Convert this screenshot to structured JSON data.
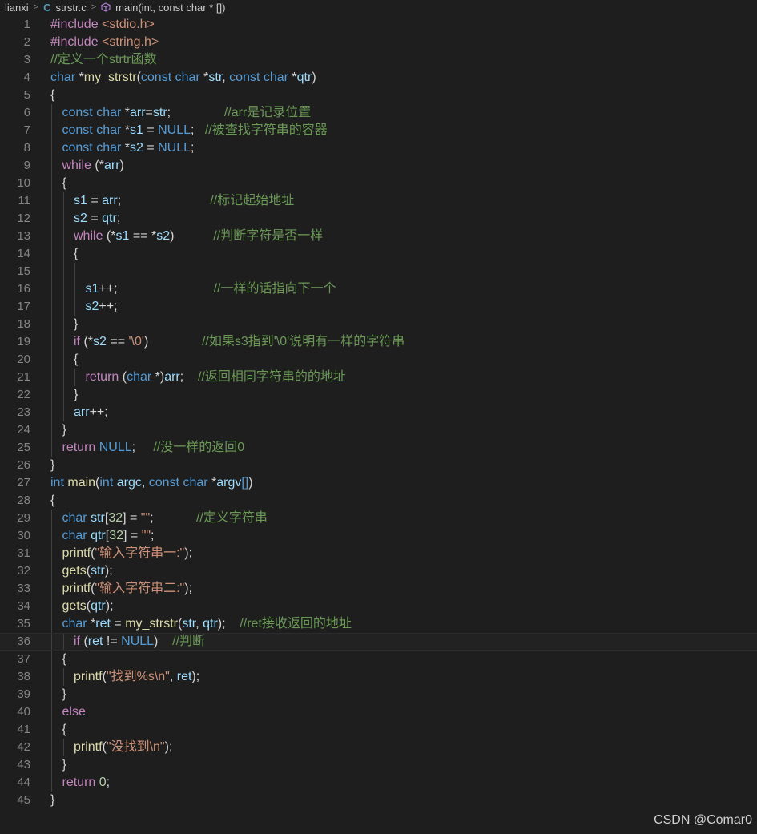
{
  "breadcrumb": {
    "folder": "lianxi",
    "file": "strstr.c",
    "symbol": "main(int, const char * [])"
  },
  "watermark": "CSDN @Comar0",
  "lines": [
    {
      "n": "1",
      "tokens": [
        [
          "pp",
          "#include "
        ],
        [
          "inc",
          "<stdio.h>"
        ]
      ]
    },
    {
      "n": "2",
      "tokens": [
        [
          "pp",
          "#include "
        ],
        [
          "inc",
          "<string.h>"
        ]
      ]
    },
    {
      "n": "3",
      "tokens": [
        [
          "cmt",
          "//定义一个strtr函数"
        ]
      ]
    },
    {
      "n": "4",
      "tokens": [
        [
          "kw",
          "char"
        ],
        [
          "txt",
          " *"
        ],
        [
          "fn",
          "my_strstr"
        ],
        [
          "txt",
          "("
        ],
        [
          "kw",
          "const char"
        ],
        [
          "txt",
          " *"
        ],
        [
          "var",
          "str"
        ],
        [
          "txt",
          ", "
        ],
        [
          "kw",
          "const char"
        ],
        [
          "txt",
          " *"
        ],
        [
          "var",
          "qtr"
        ],
        [
          "txt",
          ")"
        ]
      ]
    },
    {
      "n": "5",
      "tokens": [
        [
          "txt",
          "{"
        ]
      ]
    },
    {
      "n": "6",
      "indent": 1,
      "tokens": [
        [
          "kw",
          "const char"
        ],
        [
          "txt",
          " *"
        ],
        [
          "var",
          "arr"
        ],
        [
          "txt",
          "="
        ],
        [
          "var",
          "str"
        ],
        [
          "txt",
          ";"
        ],
        [
          "txt",
          "               "
        ],
        [
          "cmt",
          "//arr是记录位置"
        ]
      ]
    },
    {
      "n": "7",
      "indent": 1,
      "tokens": [
        [
          "kw",
          "const char"
        ],
        [
          "txt",
          " *"
        ],
        [
          "var",
          "s1"
        ],
        [
          "txt",
          " = "
        ],
        [
          "kw",
          "NULL"
        ],
        [
          "txt",
          ";   "
        ],
        [
          "cmt",
          "//被查找字符串的容器"
        ]
      ]
    },
    {
      "n": "8",
      "indent": 1,
      "tokens": [
        [
          "kw",
          "const char"
        ],
        [
          "txt",
          " *"
        ],
        [
          "var",
          "s2"
        ],
        [
          "txt",
          " = "
        ],
        [
          "kw",
          "NULL"
        ],
        [
          "txt",
          ";"
        ]
      ]
    },
    {
      "n": "9",
      "indent": 1,
      "tokens": [
        [
          "ctl",
          "while"
        ],
        [
          "txt",
          " (*"
        ],
        [
          "var",
          "arr"
        ],
        [
          "txt",
          ")"
        ]
      ]
    },
    {
      "n": "10",
      "indent": 1,
      "tokens": [
        [
          "txt",
          "{"
        ]
      ]
    },
    {
      "n": "11",
      "indent": 2,
      "tokens": [
        [
          "var",
          "s1"
        ],
        [
          "txt",
          " = "
        ],
        [
          "var",
          "arr"
        ],
        [
          "txt",
          ";"
        ],
        [
          "txt",
          "                         "
        ],
        [
          "cmt",
          "//标记起始地址"
        ]
      ]
    },
    {
      "n": "12",
      "indent": 2,
      "tokens": [
        [
          "var",
          "s2"
        ],
        [
          "txt",
          " = "
        ],
        [
          "var",
          "qtr"
        ],
        [
          "txt",
          ";"
        ]
      ]
    },
    {
      "n": "13",
      "indent": 2,
      "tokens": [
        [
          "ctl",
          "while"
        ],
        [
          "txt",
          " (*"
        ],
        [
          "var",
          "s1"
        ],
        [
          "txt",
          " == *"
        ],
        [
          "var",
          "s2"
        ],
        [
          "txt",
          ")"
        ],
        [
          "txt",
          "           "
        ],
        [
          "cmt",
          "//判断字符是否一样"
        ]
      ]
    },
    {
      "n": "14",
      "indent": 2,
      "tokens": [
        [
          "txt",
          "{"
        ]
      ]
    },
    {
      "n": "15",
      "indent": 3,
      "tokens": []
    },
    {
      "n": "16",
      "indent": 3,
      "tokens": [
        [
          "var",
          "s1"
        ],
        [
          "txt",
          "++;"
        ],
        [
          "txt",
          "                           "
        ],
        [
          "cmt",
          "//一样的话指向下一个"
        ]
      ]
    },
    {
      "n": "17",
      "indent": 3,
      "tokens": [
        [
          "var",
          "s2"
        ],
        [
          "txt",
          "++;"
        ]
      ]
    },
    {
      "n": "18",
      "indent": 2,
      "tokens": [
        [
          "txt",
          "}"
        ]
      ]
    },
    {
      "n": "19",
      "indent": 2,
      "tokens": [
        [
          "ctl",
          "if"
        ],
        [
          "txt",
          " (*"
        ],
        [
          "var",
          "s2"
        ],
        [
          "txt",
          " == "
        ],
        [
          "str",
          "'\\0'"
        ],
        [
          "txt",
          ")"
        ],
        [
          "txt",
          "               "
        ],
        [
          "cmt",
          "//如果s3指到'\\0'说明有一样的字符串"
        ]
      ]
    },
    {
      "n": "20",
      "indent": 2,
      "tokens": [
        [
          "txt",
          "{"
        ]
      ]
    },
    {
      "n": "21",
      "indent": 3,
      "tokens": [
        [
          "ctl",
          "return"
        ],
        [
          "txt",
          " ("
        ],
        [
          "kw",
          "char"
        ],
        [
          "txt",
          " *)"
        ],
        [
          "var",
          "arr"
        ],
        [
          "txt",
          ";    "
        ],
        [
          "cmt",
          "//返回相同字符串的的地址"
        ]
      ]
    },
    {
      "n": "22",
      "indent": 2,
      "tokens": [
        [
          "txt",
          "}"
        ]
      ]
    },
    {
      "n": "23",
      "indent": 2,
      "tokens": [
        [
          "var",
          "arr"
        ],
        [
          "txt",
          "++;"
        ]
      ]
    },
    {
      "n": "24",
      "indent": 1,
      "tokens": [
        [
          "txt",
          "}"
        ]
      ]
    },
    {
      "n": "25",
      "indent": 1,
      "tokens": [
        [
          "ctl",
          "return"
        ],
        [
          "txt",
          " "
        ],
        [
          "kw",
          "NULL"
        ],
        [
          "txt",
          ";     "
        ],
        [
          "cmt",
          "//没一样的返回0"
        ]
      ]
    },
    {
      "n": "26",
      "tokens": [
        [
          "txt",
          "}"
        ]
      ]
    },
    {
      "n": "27",
      "tokens": [
        [
          "kw",
          "int"
        ],
        [
          "txt",
          " "
        ],
        [
          "fn",
          "main"
        ],
        [
          "txt",
          "("
        ],
        [
          "kw",
          "int"
        ],
        [
          "txt",
          " "
        ],
        [
          "var",
          "argc"
        ],
        [
          "txt",
          ", "
        ],
        [
          "kw",
          "const char"
        ],
        [
          "txt",
          " *"
        ],
        [
          "var",
          "argv"
        ],
        [
          "kw",
          "[]"
        ],
        [
          "txt",
          ")"
        ]
      ]
    },
    {
      "n": "28",
      "tokens": [
        [
          "txt",
          "{"
        ]
      ]
    },
    {
      "n": "29",
      "indent": 1,
      "tokens": [
        [
          "kw",
          "char"
        ],
        [
          "txt",
          " "
        ],
        [
          "var",
          "str"
        ],
        [
          "txt",
          "["
        ],
        [
          "num",
          "32"
        ],
        [
          "txt",
          "] = "
        ],
        [
          "str",
          "\"\""
        ],
        [
          "txt",
          ";"
        ],
        [
          "txt",
          "            "
        ],
        [
          "cmt",
          "//定义字符串"
        ]
      ]
    },
    {
      "n": "30",
      "indent": 1,
      "tokens": [
        [
          "kw",
          "char"
        ],
        [
          "txt",
          " "
        ],
        [
          "var",
          "qtr"
        ],
        [
          "txt",
          "["
        ],
        [
          "num",
          "32"
        ],
        [
          "txt",
          "] = "
        ],
        [
          "str",
          "\"\""
        ],
        [
          "txt",
          ";"
        ]
      ]
    },
    {
      "n": "31",
      "indent": 1,
      "tokens": [
        [
          "fn",
          "printf"
        ],
        [
          "txt",
          "("
        ],
        [
          "str",
          "\"输入字符串一:\""
        ],
        [
          "txt",
          ");"
        ]
      ]
    },
    {
      "n": "32",
      "indent": 1,
      "tokens": [
        [
          "fn",
          "gets"
        ],
        [
          "txt",
          "("
        ],
        [
          "var",
          "str"
        ],
        [
          "txt",
          ");"
        ]
      ]
    },
    {
      "n": "33",
      "indent": 1,
      "tokens": [
        [
          "fn",
          "printf"
        ],
        [
          "txt",
          "("
        ],
        [
          "str",
          "\"输入字符串二:\""
        ],
        [
          "txt",
          ");"
        ]
      ]
    },
    {
      "n": "34",
      "indent": 1,
      "tokens": [
        [
          "fn",
          "gets"
        ],
        [
          "txt",
          "("
        ],
        [
          "var",
          "qtr"
        ],
        [
          "txt",
          ");"
        ]
      ]
    },
    {
      "n": "35",
      "indent": 1,
      "tokens": [
        [
          "kw",
          "char"
        ],
        [
          "txt",
          " *"
        ],
        [
          "var",
          "ret"
        ],
        [
          "txt",
          " = "
        ],
        [
          "fn",
          "my_strstr"
        ],
        [
          "txt",
          "("
        ],
        [
          "var",
          "str"
        ],
        [
          "txt",
          ", "
        ],
        [
          "var",
          "qtr"
        ],
        [
          "txt",
          ");    "
        ],
        [
          "cmt",
          "//ret接收返回的地址"
        ]
      ]
    },
    {
      "n": "36",
      "indent": 2,
      "active": true,
      "tokens": [
        [
          "ctl",
          "if"
        ],
        [
          "txt",
          " ("
        ],
        [
          "var",
          "ret"
        ],
        [
          "txt",
          " != "
        ],
        [
          "kw",
          "NULL"
        ],
        [
          "txt",
          ")    "
        ],
        [
          "cmt",
          "//判断"
        ]
      ]
    },
    {
      "n": "37",
      "indent": 1,
      "tokens": [
        [
          "txt",
          "{"
        ]
      ]
    },
    {
      "n": "38",
      "indent": 2,
      "tokens": [
        [
          "fn",
          "printf"
        ],
        [
          "txt",
          "("
        ],
        [
          "str",
          "\"找到%s\\n\""
        ],
        [
          "txt",
          ", "
        ],
        [
          "var",
          "ret"
        ],
        [
          "txt",
          ");"
        ]
      ]
    },
    {
      "n": "39",
      "indent": 1,
      "tokens": [
        [
          "txt",
          "}"
        ]
      ]
    },
    {
      "n": "40",
      "indent": 1,
      "tokens": [
        [
          "ctl",
          "else"
        ]
      ]
    },
    {
      "n": "41",
      "indent": 1,
      "tokens": [
        [
          "txt",
          "{"
        ]
      ]
    },
    {
      "n": "42",
      "indent": 2,
      "tokens": [
        [
          "fn",
          "printf"
        ],
        [
          "txt",
          "("
        ],
        [
          "str",
          "\"没找到\\n\""
        ],
        [
          "txt",
          ");"
        ]
      ]
    },
    {
      "n": "43",
      "indent": 1,
      "tokens": [
        [
          "txt",
          "}"
        ]
      ]
    },
    {
      "n": "44",
      "indent": 1,
      "tokens": [
        [
          "ctl",
          "return"
        ],
        [
          "txt",
          " "
        ],
        [
          "num",
          "0"
        ],
        [
          "txt",
          ";"
        ]
      ]
    },
    {
      "n": "45",
      "tokens": [
        [
          "txt",
          "}"
        ]
      ]
    }
  ]
}
